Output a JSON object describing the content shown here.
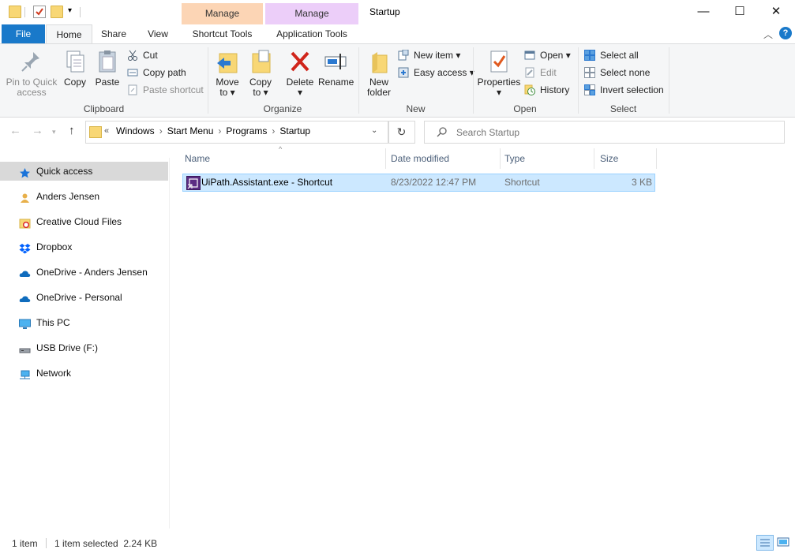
{
  "titlebar": {
    "window_title": "Startup",
    "contextual_tabs": [
      {
        "label": "Manage",
        "color": "#fcd5b5"
      },
      {
        "label": "Manage",
        "color": "#eccef9"
      }
    ],
    "controls": {
      "minimize": "—",
      "maximize": "☐",
      "close": "✕"
    }
  },
  "tabs": {
    "file": "File",
    "home": "Home",
    "share": "Share",
    "view": "View",
    "shortcut_tools": "Shortcut Tools",
    "application_tools": "Application Tools"
  },
  "ribbon": {
    "clipboard": {
      "label": "Clipboard",
      "pin_line1": "Pin to Quick",
      "pin_line2": "access",
      "copy": "Copy",
      "paste": "Paste",
      "cut": "Cut",
      "copy_path": "Copy path",
      "paste_shortcut": "Paste shortcut"
    },
    "organize": {
      "label": "Organize",
      "move_line1": "Move",
      "move_line2": "to ▾",
      "copy_line1": "Copy",
      "copy_line2": "to ▾",
      "delete": "Delete",
      "delete_arrow": "▾",
      "rename": "Rename"
    },
    "new": {
      "label": "New",
      "folder_line1": "New",
      "folder_line2": "folder",
      "new_item": "New item ▾",
      "easy_access": "Easy access ▾"
    },
    "open": {
      "label": "Open",
      "properties": "Properties",
      "properties_arrow": "▾",
      "open": "Open ▾",
      "edit": "Edit",
      "history": "History"
    },
    "select": {
      "label": "Select",
      "select_all": "Select all",
      "select_none": "Select none",
      "invert_selection": "Invert selection"
    }
  },
  "address": {
    "overflow": "«",
    "crumbs": [
      "Windows",
      "Start Menu",
      "Programs",
      "Startup"
    ],
    "separator": "›",
    "search_placeholder": "Search Startup"
  },
  "nav": {
    "items": [
      {
        "label": "Quick access",
        "icon": "star-icon",
        "selected": true
      },
      {
        "label": "Anders Jensen",
        "icon": "user-folder-icon"
      },
      {
        "label": "Creative Cloud Files",
        "icon": "creative-cloud-icon"
      },
      {
        "label": "Dropbox",
        "icon": "dropbox-icon"
      },
      {
        "label": "OneDrive - Anders Jensen",
        "icon": "onedrive-icon"
      },
      {
        "label": "OneDrive - Personal",
        "icon": "onedrive-icon"
      },
      {
        "label": "This PC",
        "icon": "computer-icon"
      },
      {
        "label": "USB Drive (F:)",
        "icon": "usb-drive-icon"
      },
      {
        "label": "Network",
        "icon": "network-icon"
      }
    ]
  },
  "files": {
    "columns": {
      "name": "Name",
      "date": "Date modified",
      "type": "Type",
      "size": "Size"
    },
    "rows": [
      {
        "name": "UiPath.Assistant.exe - Shortcut",
        "date": "8/23/2022 12:47 PM",
        "type": "Shortcut",
        "size": "3 KB"
      }
    ]
  },
  "status": {
    "count": "1 item",
    "selection": "1 item selected  2.24 KB"
  }
}
